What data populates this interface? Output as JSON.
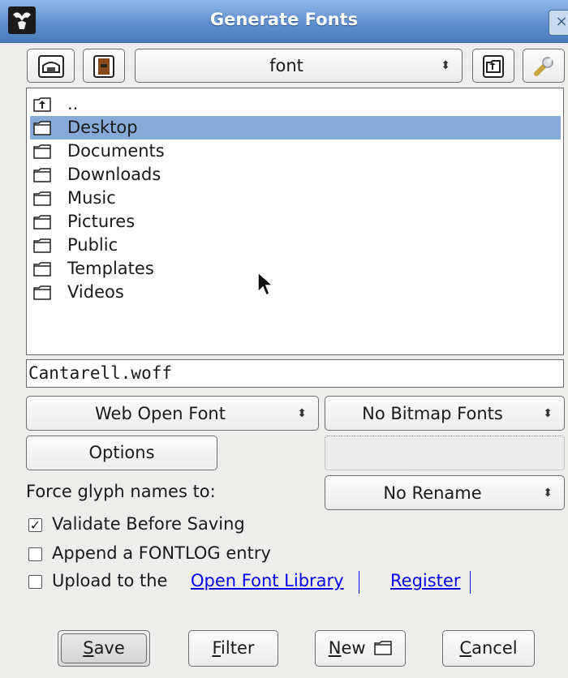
{
  "window": {
    "title": "Generate Fonts",
    "close_glyph": "×"
  },
  "toolbar": {
    "home_icon": "home-icon",
    "bookmark_icon": "bookmark-icon",
    "directory": "font",
    "up_icon": "parent-folder-icon",
    "settings_icon": "wrench-icon"
  },
  "file_list": {
    "items": [
      {
        "name": "..",
        "icon": "parent-folder-icon",
        "selected": false
      },
      {
        "name": "Desktop",
        "icon": "folder-icon",
        "selected": true
      },
      {
        "name": "Documents",
        "icon": "folder-icon",
        "selected": false
      },
      {
        "name": "Downloads",
        "icon": "folder-icon",
        "selected": false
      },
      {
        "name": "Music",
        "icon": "folder-icon",
        "selected": false
      },
      {
        "name": "Pictures",
        "icon": "folder-icon",
        "selected": false
      },
      {
        "name": "Public",
        "icon": "folder-icon",
        "selected": false
      },
      {
        "name": "Templates",
        "icon": "folder-icon",
        "selected": false
      },
      {
        "name": "Videos",
        "icon": "folder-icon",
        "selected": false
      }
    ]
  },
  "filename": {
    "value": "Cantarell.woff"
  },
  "format": {
    "outline_format": "Web Open Font",
    "bitmap_format": "No Bitmap Fonts"
  },
  "options_button": "Options",
  "glyph_names": {
    "label": "Force glyph names to:",
    "value": "No Rename"
  },
  "checkboxes": {
    "validate": {
      "label": "Validate Before Saving",
      "checked": true
    },
    "fontlog": {
      "label": "Append a FONTLOG entry",
      "checked": false
    },
    "upload": {
      "label": "Upload to the",
      "checked": false
    }
  },
  "links": {
    "library": "Open Font Library",
    "register": "Register"
  },
  "buttons": {
    "save": "ave",
    "save_mnemonic": "S",
    "filter": "ilter",
    "filter_mnemonic": "F",
    "new": "ew",
    "new_mnemonic": "N",
    "cancel": "ancel",
    "cancel_mnemonic": "C"
  },
  "colors": {
    "selection": "#86abd9",
    "titlebar": "#5f8fcf",
    "link": "#0000ee"
  }
}
